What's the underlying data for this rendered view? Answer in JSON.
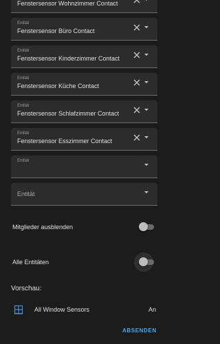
{
  "entities": [
    {
      "label": "",
      "value": "Fenstersensor Wohnzimmer Contact"
    },
    {
      "label": "Entität",
      "value": "Fenstersensor Büro Contact"
    },
    {
      "label": "Entität",
      "value": "Fenstersensor Kinderzimmer Contact"
    },
    {
      "label": "Entität",
      "value": "Fenstersensor Küche Contact"
    },
    {
      "label": "Entität",
      "value": "Fenstersensor Schlafzimmer Contact"
    },
    {
      "label": "Entität",
      "value": "Fenstersensor Esszimmer Contact"
    },
    {
      "label": "Entität",
      "value": ""
    }
  ],
  "empty_field": {
    "label": "Entität"
  },
  "options": {
    "hide_members": {
      "label": "Mitglieder ausblenden",
      "enabled": false
    },
    "all_entities": {
      "label": "Alle Entitäten",
      "enabled": false
    }
  },
  "preview": {
    "title": "Vorschau:",
    "icon": "window-icon",
    "name": "All Window Sensors",
    "state": "An"
  },
  "actions": {
    "submit_label": "ABSENDEN"
  },
  "colors": {
    "background": "#1c1c1c",
    "field": "#2c2c2c",
    "accent": "#44a6f0",
    "preview_icon": "#4d8ad6"
  }
}
